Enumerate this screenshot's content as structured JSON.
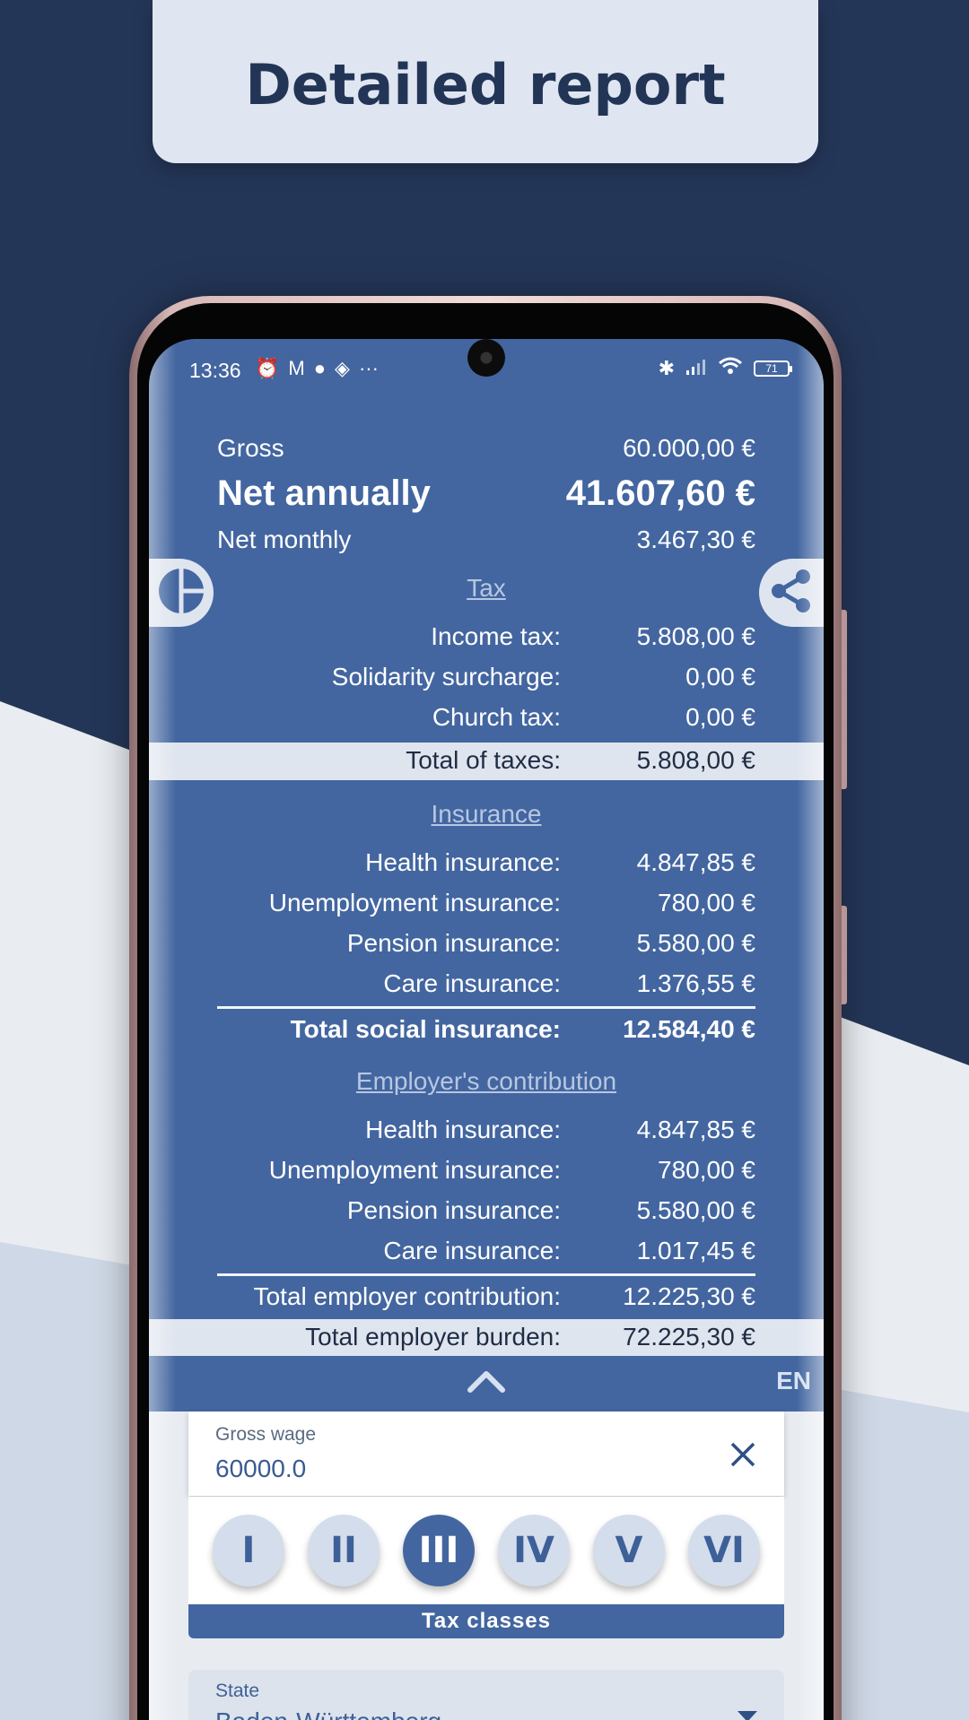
{
  "banner": {
    "title": "Detailed report"
  },
  "status_bar": {
    "time": "13:36",
    "battery": "71",
    "left_icons": [
      "alarm-icon",
      "gmail-icon",
      "app-icon",
      "layers-icon",
      "more-icon"
    ],
    "right_icons": [
      "bluetooth-icon",
      "signal-icon",
      "wifi-icon",
      "battery-icon"
    ]
  },
  "summary": {
    "gross_label": "Gross",
    "gross_value": "60.000,00 €",
    "net_annual_label": "Net annually",
    "net_annual_value": "41.607,60 €",
    "net_monthly_label": "Net monthly",
    "net_monthly_value": "3.467,30 €"
  },
  "tax": {
    "title": "Tax",
    "rows": [
      {
        "label": "Income tax:",
        "value": "5.808,00 €"
      },
      {
        "label": "Solidarity surcharge:",
        "value": "0,00 €"
      },
      {
        "label": "Church tax:",
        "value": "0,00 €"
      }
    ],
    "total_label": "Total of taxes:",
    "total_value": "5.808,00 €"
  },
  "insurance": {
    "title": "Insurance",
    "rows": [
      {
        "label": "Health insurance:",
        "value": "4.847,85 €"
      },
      {
        "label": "Unemployment insurance:",
        "value": "780,00 €"
      },
      {
        "label": "Pension insurance:",
        "value": "5.580,00 €"
      },
      {
        "label": "Care insurance:",
        "value": "1.376,55 €"
      }
    ],
    "total_label": "Total social insurance:",
    "total_value": "12.584,40 €"
  },
  "employer": {
    "title": "Employer's contribution",
    "rows": [
      {
        "label": "Health insurance:",
        "value": "4.847,85 €"
      },
      {
        "label": "Unemployment insurance:",
        "value": "780,00 €"
      },
      {
        "label": "Pension insurance:",
        "value": "5.580,00 €"
      },
      {
        "label": "Care insurance:",
        "value": "1.017,45 €"
      }
    ],
    "total_label": "Total employer contribution:",
    "total_value": "12.225,30 €",
    "burden_label": "Total employer burden:",
    "burden_value": "72.225,30 €"
  },
  "controls": {
    "language": "EN",
    "gross_wage_label": "Gross wage",
    "gross_wage_value": "60000.0",
    "tax_classes": [
      "I",
      "II",
      "III",
      "IV",
      "V",
      "VI"
    ],
    "selected_tax_class": "III",
    "tax_classes_label": "Tax classes",
    "state_label": "State",
    "state_value": "Baden-Württemberg"
  },
  "colors": {
    "screen_bg": "#4366a0",
    "banner_bg": "#dfe6f1",
    "page_bg_dark": "#243658"
  }
}
